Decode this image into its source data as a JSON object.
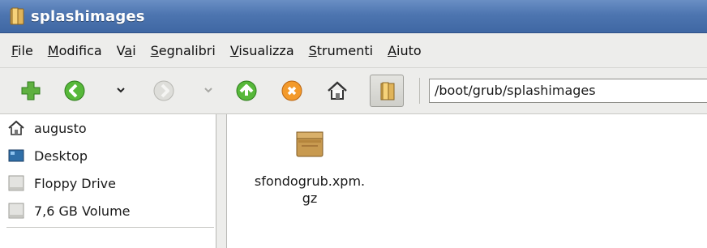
{
  "window": {
    "title": "splashimages"
  },
  "menu": [
    {
      "pre": "",
      "u": "F",
      "post": "ile"
    },
    {
      "pre": "",
      "u": "M",
      "post": "odifica"
    },
    {
      "pre": "V",
      "u": "a",
      "post": "i"
    },
    {
      "pre": "",
      "u": "S",
      "post": "egnalibri"
    },
    {
      "pre": "",
      "u": "V",
      "post": "isualizza"
    },
    {
      "pre": "",
      "u": "S",
      "post": "trumenti"
    },
    {
      "pre": "",
      "u": "A",
      "post": "iuto"
    }
  ],
  "toolbar": {
    "icons": [
      "add-icon",
      "back-icon",
      "back-dropdown-icon",
      "forward-icon",
      "forward-dropdown-icon",
      "up-icon",
      "stop-icon",
      "home-icon",
      "sidepane-toggle-icon"
    ],
    "location": "/boot/grub/splashimages"
  },
  "places": [
    {
      "label": "augusto",
      "icon": "home-icon"
    },
    {
      "label": "Desktop",
      "icon": "desktop-icon"
    },
    {
      "label": "Floppy Drive",
      "icon": "floppy-drive-icon"
    },
    {
      "label": "7,6 GB Volume",
      "icon": "volume-icon"
    }
  ],
  "files": [
    {
      "name_line1": "sfondogrub.xpm.",
      "name_line2": "gz",
      "icon": "archive-icon"
    }
  ]
}
